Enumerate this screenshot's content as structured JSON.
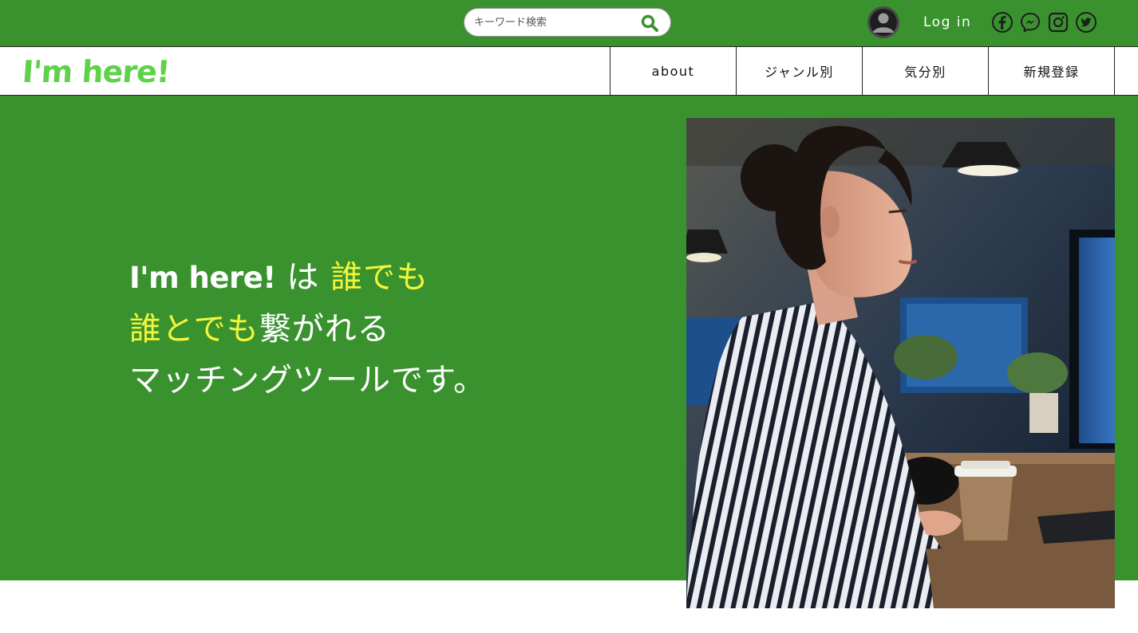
{
  "header": {
    "search": {
      "placeholder": "キーワード検索",
      "icon": "search-icon"
    },
    "avatar_icon": "user-avatar-icon",
    "login_label": "Log in",
    "social": [
      "facebook-icon",
      "messenger-icon",
      "instagram-icon",
      "twitter-icon"
    ]
  },
  "nav": {
    "logo": "I'm here!",
    "items": [
      {
        "label": "about"
      },
      {
        "label": "ジャンル別"
      },
      {
        "label": "気分別"
      },
      {
        "label": "新規登録"
      }
    ]
  },
  "hero": {
    "line1": {
      "brand": "I'm here!",
      "particle": " は ",
      "highlight": "誰でも"
    },
    "line2": {
      "highlight": "誰とでも",
      "rest": "繋がれる"
    },
    "line3": "マッチングツールです。"
  },
  "colors": {
    "brand_green": "#3a922e",
    "logo_green": "#5fd14a",
    "highlight_yellow": "#f3f53a",
    "white": "#ffffff"
  }
}
